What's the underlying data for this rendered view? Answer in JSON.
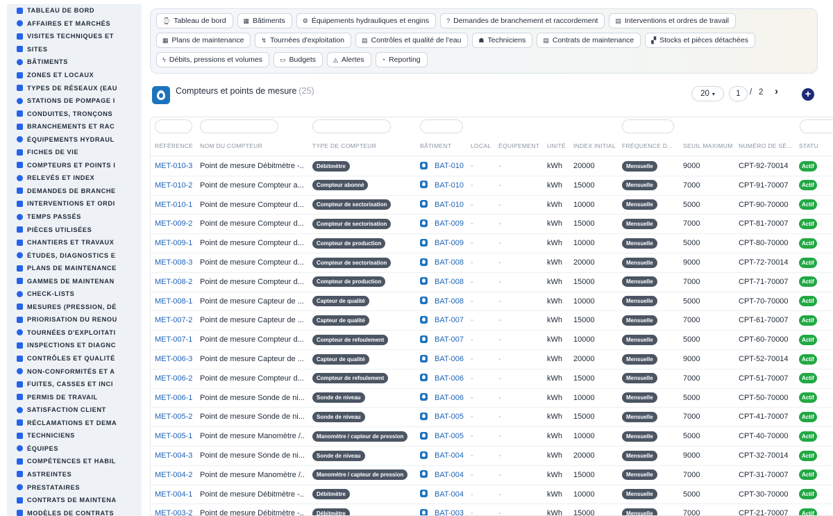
{
  "sidebar": {
    "items": [
      {
        "label": "TABLEAU DE BORD",
        "icon": "dashboard-icon"
      },
      {
        "label": "AFFAIRES ET MARCHÉS",
        "icon": "target-icon"
      },
      {
        "label": "VISITES TECHNIQUES ET",
        "icon": "clipboard-icon"
      },
      {
        "label": "SITES",
        "icon": "location-pin-icon"
      },
      {
        "label": "BÂTIMENTS",
        "icon": "building-icon"
      },
      {
        "label": "ZONES ET LOCAUX",
        "icon": "layers-icon"
      },
      {
        "label": "TYPES DE RÉSEAUX (EAU",
        "icon": "network-icon"
      },
      {
        "label": "STATIONS DE POMPAGE I",
        "icon": "grid-icon"
      },
      {
        "label": "CONDUITES, TRONÇONS",
        "icon": "pipe-icon"
      },
      {
        "label": "BRANCHEMENTS ET RAC",
        "icon": "equals-icon"
      },
      {
        "label": "ÉQUIPEMENTS HYDRAUL",
        "icon": "gears-icon"
      },
      {
        "label": "FICHES DE VIE",
        "icon": "history-icon"
      },
      {
        "label": "COMPTEURS ET POINTS I",
        "icon": "gauge-icon"
      },
      {
        "label": "RELEVÉS ET INDEX",
        "icon": "list-icon"
      },
      {
        "label": "DEMANDES DE BRANCHE",
        "icon": "question-icon"
      },
      {
        "label": "INTERVENTIONS ET ORDI",
        "icon": "clipboard-check-icon"
      },
      {
        "label": "TEMPS PASSÉS",
        "icon": "clock-icon"
      },
      {
        "label": "PIÈCES UTILISÉES",
        "icon": "clipboard-list-icon"
      },
      {
        "label": "CHANTIERS ET TRAVAUX",
        "icon": "hammer-icon"
      },
      {
        "label": "ÉTUDES, DIAGNOSTICS E",
        "icon": "book-icon"
      },
      {
        "label": "PLANS DE MAINTENANCE",
        "icon": "calendar-icon"
      },
      {
        "label": "GAMMES DE MAINTENAN",
        "icon": "checklist-icon"
      },
      {
        "label": "CHECK-LISTS",
        "icon": "list-check-icon"
      },
      {
        "label": "MESURES (PRESSION, DÉ",
        "icon": "chart-icon"
      },
      {
        "label": "PRIORISATION DU RENOU",
        "icon": "bar-chart-icon"
      },
      {
        "label": "TOURNÉES D'EXPLOITATI",
        "icon": "route-icon"
      },
      {
        "label": "INSPECTIONS ET DIAGNC",
        "icon": "search-icon"
      },
      {
        "label": "CONTRÔLES ET QUALITÉ",
        "icon": "clipboard-icon"
      },
      {
        "label": "NON-CONFORMITÉS ET A",
        "icon": "alert-circle-icon"
      },
      {
        "label": "FUITES, CASSES ET INCI",
        "icon": "warning-icon"
      },
      {
        "label": "PERMIS DE TRAVAIL",
        "icon": "file-signature-icon"
      },
      {
        "label": "SATISFACTION CLIENT",
        "icon": "smile-icon"
      },
      {
        "label": "RÉCLAMATIONS ET DEMA",
        "icon": "comment-icon"
      },
      {
        "label": "TECHNICIENS",
        "icon": "helmet-icon"
      },
      {
        "label": "ÉQUIPES",
        "icon": "users-icon"
      },
      {
        "label": "COMPÉTENCES ET HABIL",
        "icon": "certificate-icon"
      },
      {
        "label": "ASTREINTES",
        "icon": "phone-icon"
      },
      {
        "label": "PRESTATAIRES",
        "icon": "briefcase-icon"
      },
      {
        "label": "CONTRATS DE MAINTENA",
        "icon": "file-contract-icon"
      },
      {
        "label": "MODÈLES DE CONTRATS",
        "icon": "file-icon"
      }
    ]
  },
  "modules": {
    "rows": [
      [
        {
          "label": "Tableau de bord",
          "icon": "⌚"
        },
        {
          "label": "Bâtiments",
          "icon": "▦"
        },
        {
          "label": "Équipements hydrauliques et engins",
          "icon": "⚙"
        },
        {
          "label": "Demandes de branchement et raccordement",
          "icon": "?"
        },
        {
          "label": "Interventions et ordres de travail",
          "icon": "▤"
        }
      ],
      [
        {
          "label": "Plans de maintenance",
          "icon": "▦"
        },
        {
          "label": "Tournées d'exploitation",
          "icon": "↯"
        },
        {
          "label": "Contrôles et qualité de l'eau",
          "icon": "▤"
        },
        {
          "label": "Techniciens",
          "icon": "☗"
        },
        {
          "label": "Contrats de maintenance",
          "icon": "▤"
        },
        {
          "label": "Stocks et pièces détachées",
          "icon": "▞"
        }
      ],
      [
        {
          "label": "Débits, pressions et volumes",
          "icon": "ϟ"
        },
        {
          "label": "Budgets",
          "icon": "▭"
        },
        {
          "label": "Alertes",
          "icon": "◬"
        },
        {
          "label": "Reporting",
          "icon": "◔"
        }
      ]
    ]
  },
  "page": {
    "title": "Compteurs et points de mesure",
    "count": "(25)"
  },
  "pager": {
    "page_size": "20",
    "current_page": "1",
    "separator": "/",
    "total_pages": "2",
    "next_icon": "›",
    "add_icon": "+"
  },
  "table": {
    "columns": [
      "RÉFÉRENCE",
      "NOM DU COMPTEUR",
      "TYPE DE COMPTEUR",
      "BÂTIMENT",
      "LOCAL",
      "ÉQUIPEMENT",
      "UNITÉ",
      "INDEX INITIAL",
      "FRÉQUENCE D...",
      "SEUIL MAXIMUM",
      "NUMÉRO DE SÉ...",
      "STATU"
    ],
    "rows": [
      {
        "ref": "MET-010-3",
        "name": "Point de mesure Débitmètre -...",
        "type": "Débitmètre",
        "bat": "BAT-010",
        "local": "-",
        "equip": "-",
        "unit": "kWh",
        "index": "20000",
        "freq": "Mensuelle",
        "seuil": "9000",
        "serial": "CPT-92-70014",
        "status": "Actif"
      },
      {
        "ref": "MET-010-2",
        "name": "Point de mesure Compteur a...",
        "type": "Compteur abonné",
        "bat": "BAT-010",
        "local": "-",
        "equip": "-",
        "unit": "kWh",
        "index": "15000",
        "freq": "Mensuelle",
        "seuil": "7000",
        "serial": "CPT-91-70007",
        "status": "Actif"
      },
      {
        "ref": "MET-010-1",
        "name": "Point de mesure Compteur d...",
        "type": "Compteur de sectorisation",
        "bat": "BAT-010",
        "local": "-",
        "equip": "-",
        "unit": "kWh",
        "index": "10000",
        "freq": "Mensuelle",
        "seuil": "5000",
        "serial": "CPT-90-70000",
        "status": "Actif"
      },
      {
        "ref": "MET-009-2",
        "name": "Point de mesure Compteur d...",
        "type": "Compteur de sectorisation",
        "bat": "BAT-009",
        "local": "-",
        "equip": "-",
        "unit": "kWh",
        "index": "15000",
        "freq": "Mensuelle",
        "seuil": "7000",
        "serial": "CPT-81-70007",
        "status": "Actif"
      },
      {
        "ref": "MET-009-1",
        "name": "Point de mesure Compteur d...",
        "type": "Compteur de production",
        "bat": "BAT-009",
        "local": "-",
        "equip": "-",
        "unit": "kWh",
        "index": "10000",
        "freq": "Mensuelle",
        "seuil": "5000",
        "serial": "CPT-80-70000",
        "status": "Actif"
      },
      {
        "ref": "MET-008-3",
        "name": "Point de mesure Compteur d...",
        "type": "Compteur de sectorisation",
        "bat": "BAT-008",
        "local": "-",
        "equip": "-",
        "unit": "kWh",
        "index": "20000",
        "freq": "Mensuelle",
        "seuil": "9000",
        "serial": "CPT-72-70014",
        "status": "Actif"
      },
      {
        "ref": "MET-008-2",
        "name": "Point de mesure Compteur d...",
        "type": "Compteur de production",
        "bat": "BAT-008",
        "local": "-",
        "equip": "-",
        "unit": "kWh",
        "index": "15000",
        "freq": "Mensuelle",
        "seuil": "7000",
        "serial": "CPT-71-70007",
        "status": "Actif"
      },
      {
        "ref": "MET-008-1",
        "name": "Point de mesure Capteur de ...",
        "type": "Capteur de qualité",
        "bat": "BAT-008",
        "local": "-",
        "equip": "-",
        "unit": "kWh",
        "index": "10000",
        "freq": "Mensuelle",
        "seuil": "5000",
        "serial": "CPT-70-70000",
        "status": "Actif"
      },
      {
        "ref": "MET-007-2",
        "name": "Point de mesure Capteur de ...",
        "type": "Capteur de qualité",
        "bat": "BAT-007",
        "local": "-",
        "equip": "-",
        "unit": "kWh",
        "index": "15000",
        "freq": "Mensuelle",
        "seuil": "7000",
        "serial": "CPT-61-70007",
        "status": "Actif"
      },
      {
        "ref": "MET-007-1",
        "name": "Point de mesure Compteur d...",
        "type": "Compteur de refoulement",
        "bat": "BAT-007",
        "local": "-",
        "equip": "-",
        "unit": "kWh",
        "index": "10000",
        "freq": "Mensuelle",
        "seuil": "5000",
        "serial": "CPT-60-70000",
        "status": "Actif"
      },
      {
        "ref": "MET-006-3",
        "name": "Point de mesure Capteur de ...",
        "type": "Capteur de qualité",
        "bat": "BAT-006",
        "local": "-",
        "equip": "-",
        "unit": "kWh",
        "index": "20000",
        "freq": "Mensuelle",
        "seuil": "9000",
        "serial": "CPT-52-70014",
        "status": "Actif"
      },
      {
        "ref": "MET-006-2",
        "name": "Point de mesure Compteur d...",
        "type": "Compteur de refoulement",
        "bat": "BAT-006",
        "local": "-",
        "equip": "-",
        "unit": "kWh",
        "index": "15000",
        "freq": "Mensuelle",
        "seuil": "7000",
        "serial": "CPT-51-70007",
        "status": "Actif"
      },
      {
        "ref": "MET-006-1",
        "name": "Point de mesure Sonde de ni...",
        "type": "Sonde de niveau",
        "bat": "BAT-006",
        "local": "-",
        "equip": "-",
        "unit": "kWh",
        "index": "10000",
        "freq": "Mensuelle",
        "seuil": "5000",
        "serial": "CPT-50-70000",
        "status": "Actif"
      },
      {
        "ref": "MET-005-2",
        "name": "Point de mesure Sonde de ni...",
        "type": "Sonde de niveau",
        "bat": "BAT-005",
        "local": "-",
        "equip": "-",
        "unit": "kWh",
        "index": "15000",
        "freq": "Mensuelle",
        "seuil": "7000",
        "serial": "CPT-41-70007",
        "status": "Actif"
      },
      {
        "ref": "MET-005-1",
        "name": "Point de mesure Manomètre /...",
        "type": "Manomètre / capteur de pression",
        "bat": "BAT-005",
        "local": "-",
        "equip": "-",
        "unit": "kWh",
        "index": "10000",
        "freq": "Mensuelle",
        "seuil": "5000",
        "serial": "CPT-40-70000",
        "status": "Actif"
      },
      {
        "ref": "MET-004-3",
        "name": "Point de mesure Sonde de ni...",
        "type": "Sonde de niveau",
        "bat": "BAT-004",
        "local": "-",
        "equip": "-",
        "unit": "kWh",
        "index": "20000",
        "freq": "Mensuelle",
        "seuil": "9000",
        "serial": "CPT-32-70014",
        "status": "Actif"
      },
      {
        "ref": "MET-004-2",
        "name": "Point de mesure Manomètre /...",
        "type": "Manomètre / capteur de pression",
        "bat": "BAT-004",
        "local": "-",
        "equip": "-",
        "unit": "kWh",
        "index": "15000",
        "freq": "Mensuelle",
        "seuil": "7000",
        "serial": "CPT-31-70007",
        "status": "Actif"
      },
      {
        "ref": "MET-004-1",
        "name": "Point de mesure Débitmètre -...",
        "type": "Débitmètre",
        "bat": "BAT-004",
        "local": "-",
        "equip": "-",
        "unit": "kWh",
        "index": "10000",
        "freq": "Mensuelle",
        "seuil": "5000",
        "serial": "CPT-30-70000",
        "status": "Actif"
      },
      {
        "ref": "MET-003-2",
        "name": "Point de mesure Débitmètre -...",
        "type": "Débitmètre",
        "bat": "BAT-003",
        "local": "-",
        "equip": "-",
        "unit": "kWh",
        "index": "15000",
        "freq": "Mensuelle",
        "seuil": "7000",
        "serial": "CPT-21-70007",
        "status": "Actif"
      }
    ]
  },
  "colors": {
    "accent": "#1e63b5",
    "badge_dark": "#4b5563",
    "status_active": "#22a844",
    "add_button": "#1e2a78"
  }
}
